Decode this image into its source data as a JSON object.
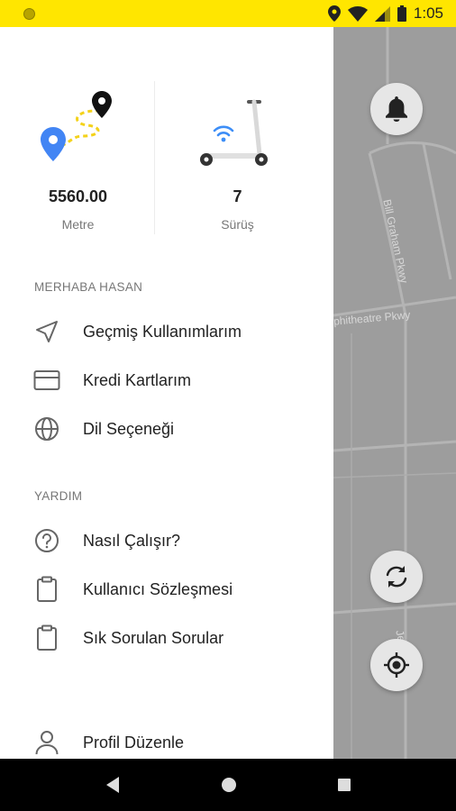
{
  "status_bar": {
    "time": "1:05",
    "icons": [
      "location-icon",
      "wifi-icon",
      "signal-icon",
      "battery-icon"
    ]
  },
  "stats": {
    "distance": {
      "value": "5560.00",
      "label": "Metre"
    },
    "rides": {
      "value": "7",
      "label": "Sürüş"
    }
  },
  "menu": {
    "greeting_section": "MERHABA HASAN",
    "items": [
      {
        "label": "Geçmiş Kullanımlarım",
        "icon": "navigation-arrow-icon"
      },
      {
        "label": "Kredi Kartlarım",
        "icon": "credit-card-icon"
      },
      {
        "label": "Dil Seçeneği",
        "icon": "globe-icon"
      }
    ],
    "help_section": "YARDIM",
    "help_items": [
      {
        "label": "Nasıl Çalışır?",
        "icon": "help-circle-icon"
      },
      {
        "label": "Kullanıcı Sözleşmesi",
        "icon": "clipboard-icon"
      },
      {
        "label": "Sık Sorulan Sorular",
        "icon": "clipboard-icon"
      }
    ],
    "profile": {
      "label": "Profil Düzenle",
      "icon": "user-icon"
    }
  },
  "map": {
    "street_labels": [
      "Bill Graham Pkwy",
      "phitheatre Pkwy",
      "Je"
    ]
  },
  "colors": {
    "accent": "#ffe600",
    "map_gray": "#9d9d9d",
    "pin_blue": "#4285f4",
    "wifi_blue": "#3d8ef7"
  }
}
